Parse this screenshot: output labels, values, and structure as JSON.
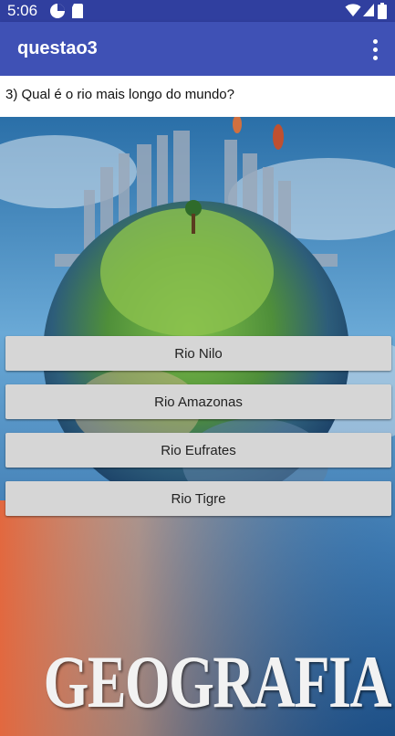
{
  "status_bar": {
    "time": "5:06",
    "icons": [
      "data-saver-icon",
      "sim-card-icon",
      "wifi-icon",
      "signal-icon",
      "battery-icon"
    ]
  },
  "app_bar": {
    "title": "questao3",
    "overflow_icon": "more-vert-icon",
    "color": "#3f51b5",
    "status_color": "#303f9f"
  },
  "question": {
    "text": "3) Qual é o rio mais longo do mundo?"
  },
  "answers": [
    {
      "label": "Rio Nilo"
    },
    {
      "label": "Rio Amazonas"
    },
    {
      "label": "Rio Eufrates"
    },
    {
      "label": "Rio Tigre"
    }
  ],
  "background_image": {
    "caption": "GEOGRAFIA"
  }
}
